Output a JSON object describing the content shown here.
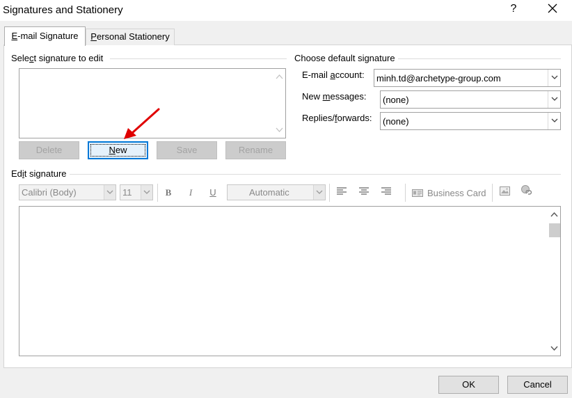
{
  "window": {
    "title": "Signatures and Stationery",
    "help_label": "?"
  },
  "tabs": [
    {
      "prefix": "",
      "key": "E",
      "suffix": "-mail Signature"
    },
    {
      "prefix": "",
      "key": "P",
      "suffix": "ersonal Stationery"
    }
  ],
  "select_group": {
    "prefix": "Sele",
    "key": "c",
    "suffix": "t signature to edit"
  },
  "buttons": {
    "delete": "Delete",
    "new_key": "N",
    "new_rest": "ew",
    "save": "Save",
    "rename": "Rename"
  },
  "default_group": {
    "label": "Choose default signature"
  },
  "fields": {
    "email_account": {
      "prefix": "E-mail ",
      "key": "a",
      "suffix": "ccount:",
      "value": "minh.td@archetype-group.com"
    },
    "new_messages": {
      "prefix": "New ",
      "key": "m",
      "suffix": "essages:",
      "value": "(none)"
    },
    "replies": {
      "prefix": "Replies/",
      "key": "f",
      "suffix": "orwards:",
      "value": "(none)"
    }
  },
  "edit_group": {
    "prefix": "Ed",
    "key": "i",
    "suffix": "t signature"
  },
  "toolbar": {
    "font": "Calibri (Body)",
    "size": "11",
    "bold": "B",
    "italic": "I",
    "underline": "U",
    "color": "Automatic",
    "business_card": "Business Card"
  },
  "footer": {
    "ok": "OK",
    "cancel": "Cancel"
  },
  "colors": {
    "focus_blue": "#0078d7",
    "annotation_arrow": "#e00000"
  }
}
